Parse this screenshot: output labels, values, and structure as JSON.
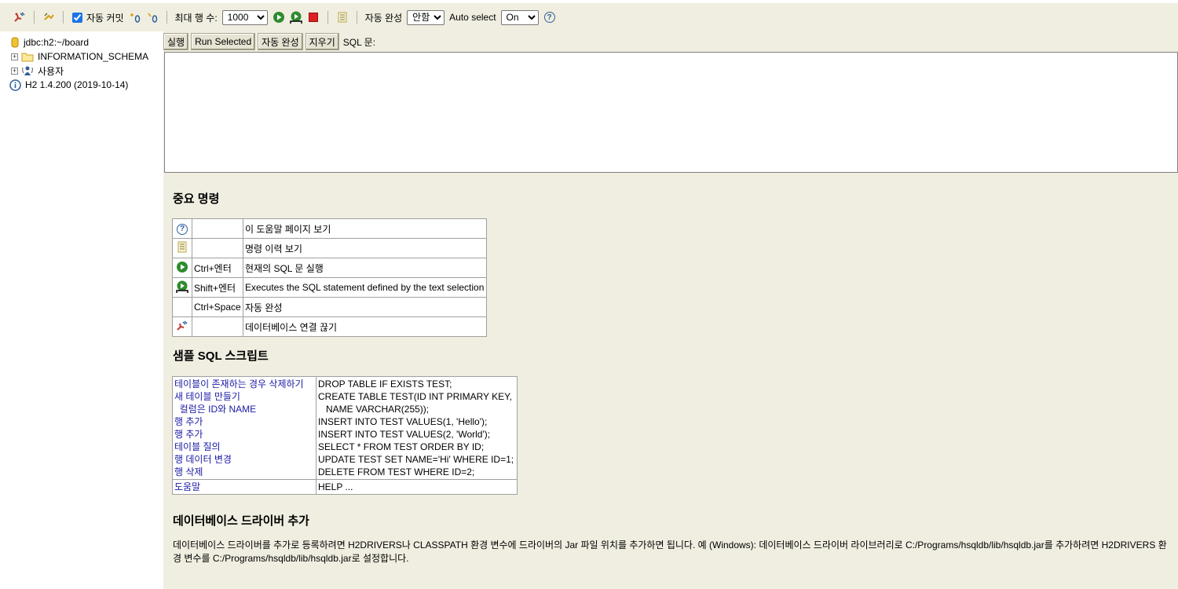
{
  "toolbar": {
    "autocommit_label": "자동 커밋",
    "max_rows_label": "최대 행 수:",
    "max_rows_value": "1000",
    "autocomplete_label": "자동 완성",
    "autocomplete_value": "안함",
    "auto_select_label": "Auto select",
    "auto_select_value": "On"
  },
  "tree": {
    "connection": "jdbc:h2:~/board",
    "schema": "INFORMATION_SCHEMA",
    "users": "사용자",
    "version": "H2 1.4.200 (2019-10-14)"
  },
  "query": {
    "run_label": "실행",
    "run_selected_label": "Run Selected",
    "autocomplete_label": "자동 완성",
    "clear_label": "지우기",
    "sql_label": "SQL 문:"
  },
  "help": {
    "important_title": "중요 명령",
    "commands": [
      {
        "key": "",
        "desc": "이 도움말 페이지 보기"
      },
      {
        "key": "",
        "desc": "명령 이력 보기"
      },
      {
        "key": "Ctrl+엔터",
        "desc": "현재의 SQL 문 실행"
      },
      {
        "key": "Shift+엔터",
        "desc": "Executes the SQL statement defined by the text selection"
      },
      {
        "key": "Ctrl+Space",
        "desc": "자동 완성"
      },
      {
        "key": "",
        "desc": "데이터베이스 연결 끊기"
      }
    ],
    "sample_title": "샘플 SQL 스크립트",
    "samples": [
      {
        "label": "테이블이 존재하는 경우 삭제하기",
        "sql": "DROP TABLE IF EXISTS TEST;"
      },
      {
        "label": "새 테이블 만들기",
        "sql": "CREATE TABLE TEST(ID INT PRIMARY KEY,"
      },
      {
        "label": "  컬럼은 ID와 NAME",
        "sql": "   NAME VARCHAR(255));"
      },
      {
        "label": "행 추가",
        "sql": "INSERT INTO TEST VALUES(1, 'Hello');"
      },
      {
        "label": "행 추가",
        "sql": "INSERT INTO TEST VALUES(2, 'World');"
      },
      {
        "label": "테이블 질의",
        "sql": "SELECT * FROM TEST ORDER BY ID;"
      },
      {
        "label": "행 데이터 변경",
        "sql": "UPDATE TEST SET NAME='Hi' WHERE ID=1;"
      },
      {
        "label": "행 삭제",
        "sql": "DELETE FROM TEST WHERE ID=2;"
      }
    ],
    "help_label": "도움말",
    "help_sql": "HELP ...",
    "driver_title": "데이터베이스 드라이버 추가",
    "driver_line1": "데이터베이스 드라이버를 추가로 등록하려면 H2DRIVERS나 CLASSPATH 환경 변수에 드라이버의 Jar 파일 위치를 추가하면 됩니다. 예 (Windows): 데이터베이스 드라이버 라이브러리로 C:/Programs/hsqldb/lib/hsqldb.jar를 추가하려면 H2DRIVERS 환",
    "driver_line2": "경 변수를 C:/Programs/hsqldb/lib/hsqldb.jar로 설정합니다."
  }
}
